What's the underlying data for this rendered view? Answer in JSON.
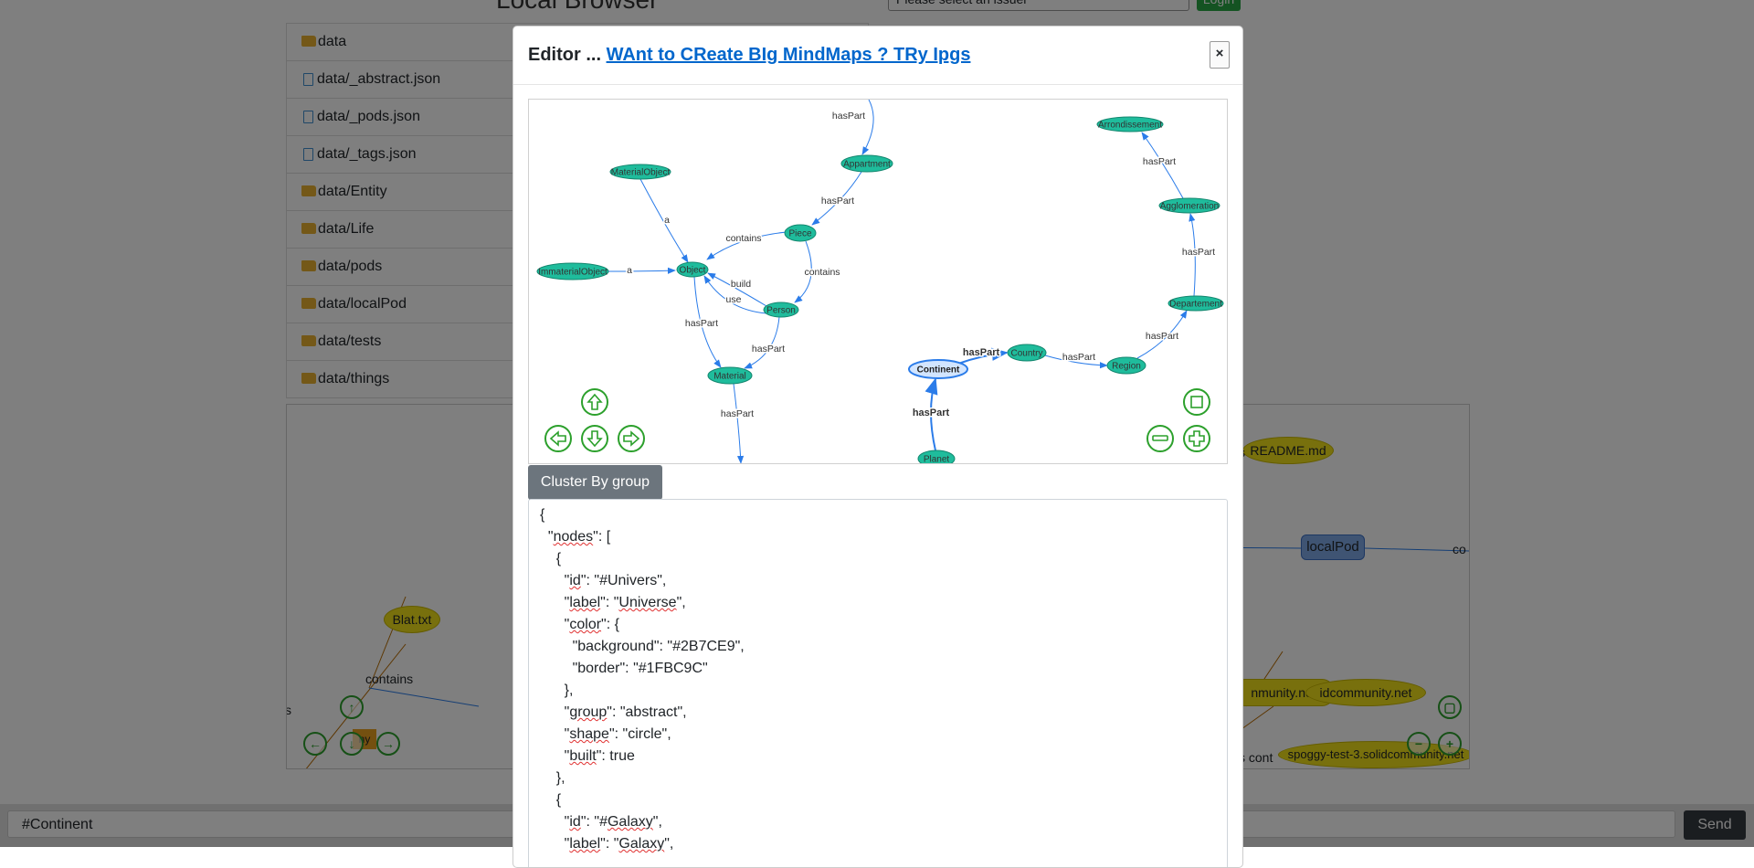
{
  "background": {
    "title": "Local Browser",
    "select_placeholder": "Please select an issuer",
    "login_label": "Login",
    "file_items": [
      {
        "label": "data",
        "type": "folder"
      },
      {
        "label": "data/_abstract.json",
        "type": "file"
      },
      {
        "label": "data/_pods.json",
        "type": "file"
      },
      {
        "label": "data/_tags.json",
        "type": "file"
      },
      {
        "label": "data/Entity",
        "type": "folder"
      },
      {
        "label": "data/Life",
        "type": "folder"
      },
      {
        "label": "data/pods",
        "type": "folder"
      },
      {
        "label": "data/localPod",
        "type": "folder"
      },
      {
        "label": "data/tests",
        "type": "folder"
      },
      {
        "label": "data/things",
        "type": "folder"
      }
    ],
    "graph": {
      "readme_label": "README.md",
      "blat_label": "Blat.txt",
      "localpod_label": "localPod",
      "contains_label": "contains",
      "solid1_label": "nmunity.net",
      "solid2_label": "idcommunity.net",
      "spoggy_label": "spoggy-test-3.solidcommunity.net",
      "fragment_s": "s",
      "fragment_co": "co",
      "fragment_ny": "ny",
      "fragment_scont": "s cont"
    },
    "bottom_input_value": "#Continent",
    "send_label": "Send"
  },
  "modal": {
    "title_prefix": "Editor ...",
    "title_link": "WAnt to CReate BIg MindMaps ? TRy Ipgs",
    "close_label": "×",
    "cluster_button": "Cluster By group",
    "network": {
      "nodes": [
        {
          "id": "Arrondissement",
          "label": "Arrondissement"
        },
        {
          "id": "Appartment",
          "label": "Appartment"
        },
        {
          "id": "MaterialObject",
          "label": "MaterialObject"
        },
        {
          "id": "Agglomeration",
          "label": "Agglomeration"
        },
        {
          "id": "Piece",
          "label": "Piece"
        },
        {
          "id": "ImmaterialObject",
          "label": "ImmaterialObject"
        },
        {
          "id": "Object",
          "label": "Object"
        },
        {
          "id": "Person",
          "label": "Person"
        },
        {
          "id": "Departement",
          "label": "Departement"
        },
        {
          "id": "Country",
          "label": "Country"
        },
        {
          "id": "Continent",
          "label": "Continent"
        },
        {
          "id": "Region",
          "label": "Region"
        },
        {
          "id": "Material",
          "label": "Material"
        },
        {
          "id": "Planet",
          "label": "Planet"
        }
      ],
      "edge_labels": {
        "haspart": "hasPart",
        "a": "a",
        "contains": "contains",
        "build": "build",
        "use": "use"
      }
    },
    "json_lines": [
      "{",
      "  \"nodes\": [",
      "    {",
      "      \"id\": \"#Univers\",",
      "      \"label\": \"Universe\",",
      "      \"color\": {",
      "        \"background\": \"#2B7CE9\",",
      "        \"border\": \"#1FBC9C\"",
      "      },",
      "      \"group\": \"abstract\",",
      "      \"shape\": \"circle\",",
      "      \"built\": true",
      "    },",
      "    {",
      "      \"id\": \"#Galaxy\",",
      "      \"label\": \"Galaxy\","
    ]
  },
  "colors": {
    "node_fill": "#1fbc9c",
    "node_border": "#13876f",
    "edge": "#2b7ce9",
    "selected_fill": "#d2e5ff",
    "selected_border": "#2b7ce9",
    "nav_green": "#2ca02c",
    "link": "#0066cc"
  }
}
